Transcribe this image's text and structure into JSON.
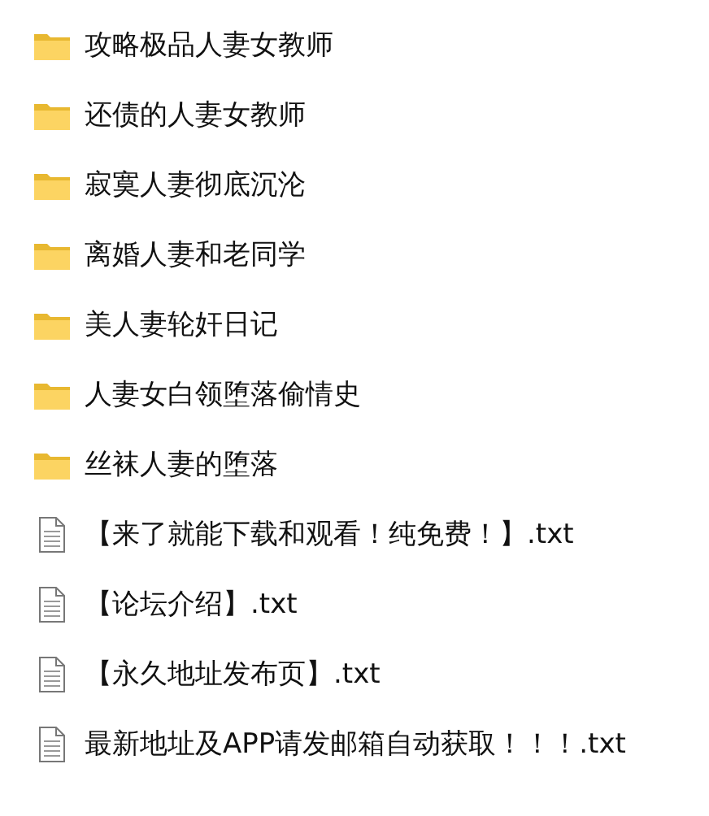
{
  "items": [
    {
      "kind": "folder",
      "name": "攻略极品人妻女教师"
    },
    {
      "kind": "folder",
      "name": "还债的人妻女教师"
    },
    {
      "kind": "folder",
      "name": "寂寞人妻彻底沉沦"
    },
    {
      "kind": "folder",
      "name": "离婚人妻和老同学"
    },
    {
      "kind": "folder",
      "name": "美人妻轮奸日记"
    },
    {
      "kind": "folder",
      "name": "人妻女白领堕落偷情史"
    },
    {
      "kind": "folder",
      "name": "丝袜人妻的堕落"
    },
    {
      "kind": "file",
      "name": "【来了就能下载和观看！纯免费！】.txt"
    },
    {
      "kind": "file",
      "name": "【论坛介绍】.txt"
    },
    {
      "kind": "file",
      "name": "【永久地址发布页】.txt"
    },
    {
      "kind": "file",
      "name": "最新地址及APP请发邮箱自动获取！！！.txt"
    }
  ]
}
